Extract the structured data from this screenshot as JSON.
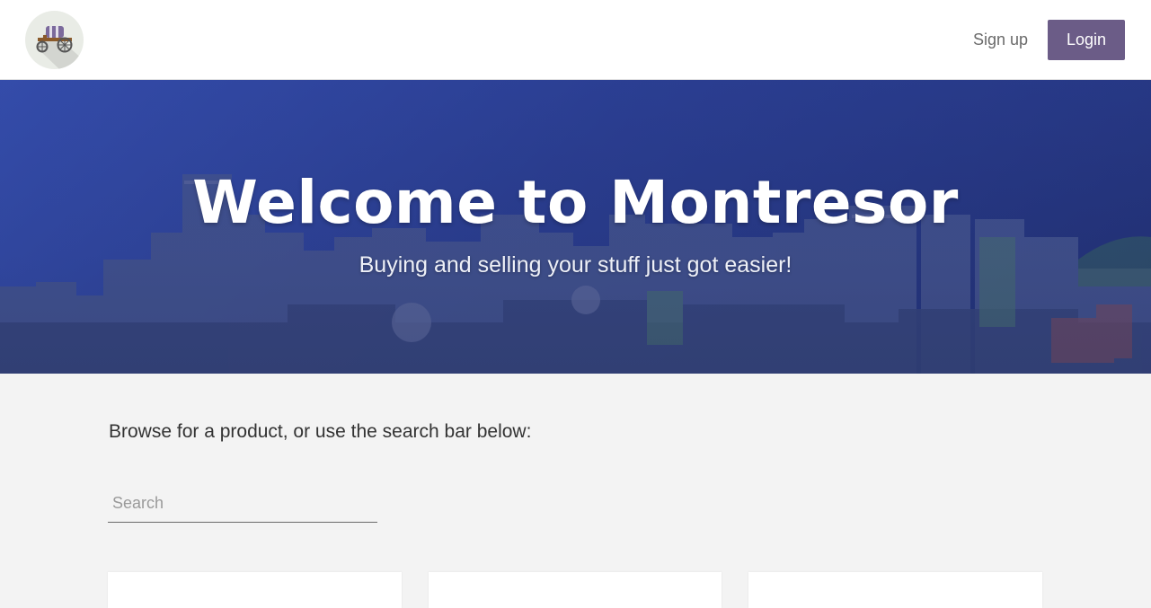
{
  "navbar": {
    "logo_icon": "wagon-icon",
    "signup_label": "Sign up",
    "login_label": "Login",
    "accent_color": "#6b5c87"
  },
  "hero": {
    "title": "Welcome to Montresor",
    "subtitle": "Buying and selling your stuff just got easier!",
    "overlay_color": "#2c3f8f"
  },
  "main": {
    "browse_text": "Browse for a product, or use the search bar below:",
    "search": {
      "placeholder": "Search",
      "value": ""
    },
    "product_cards": 3
  }
}
